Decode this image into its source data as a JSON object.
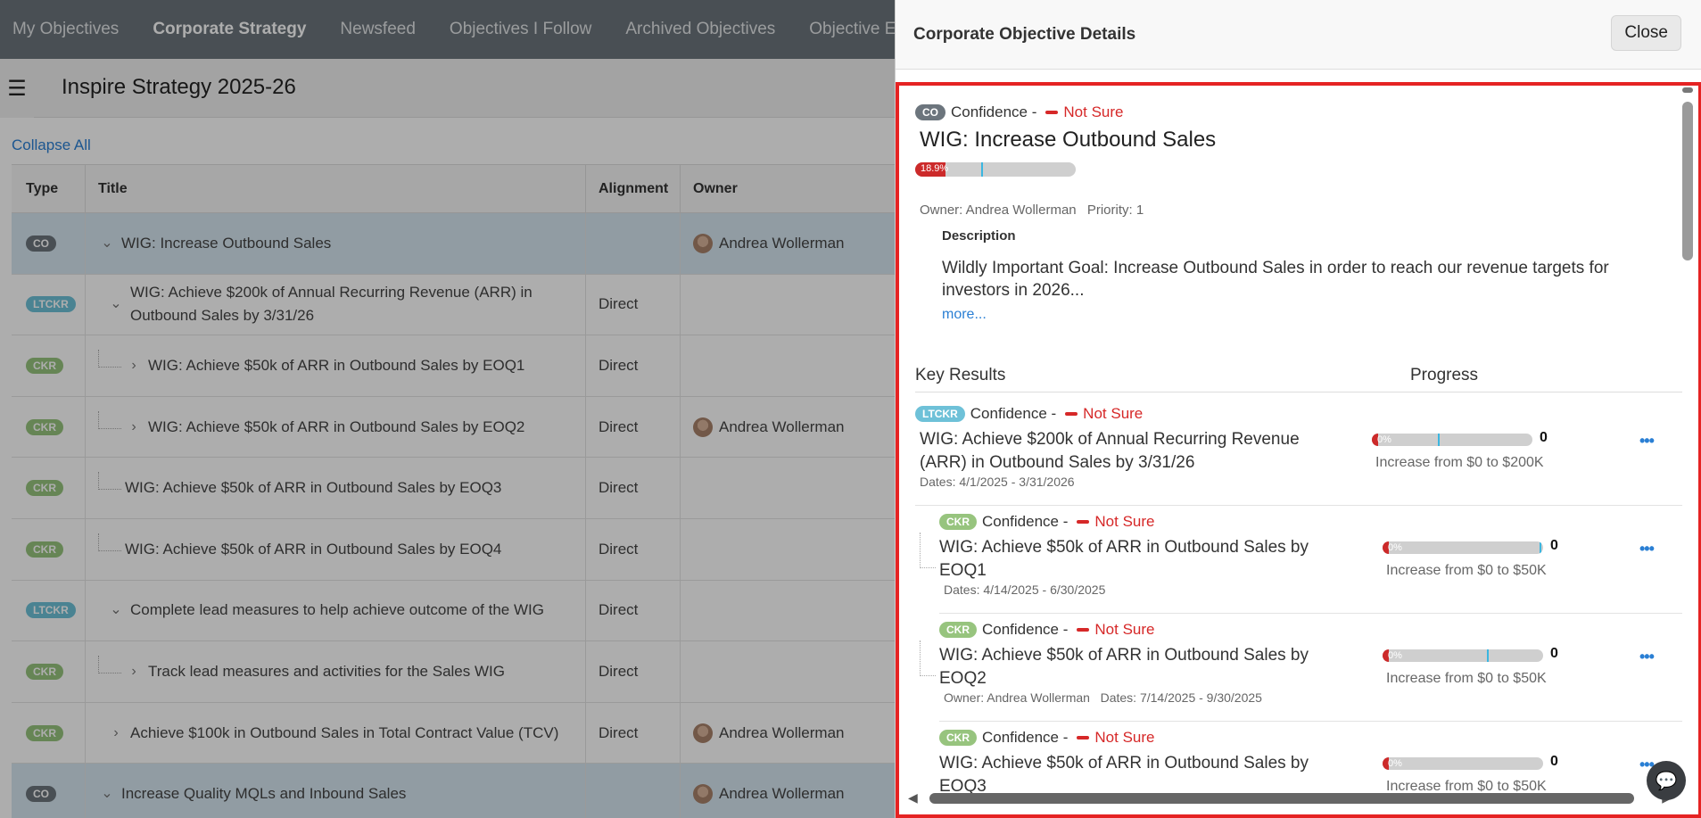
{
  "topnav": {
    "tabs": [
      {
        "label": "My Objectives"
      },
      {
        "label": "Corporate Strategy"
      },
      {
        "label": "Newsfeed"
      },
      {
        "label": "Objectives I Follow"
      },
      {
        "label": "Archived Objectives"
      },
      {
        "label": "Objective E"
      }
    ]
  },
  "page": {
    "menu_icon": "☰",
    "title": "Inspire Strategy 2025-26",
    "collapse_all": "Collapse All"
  },
  "grid": {
    "headers": {
      "type": "Type",
      "title": "Title",
      "alignment": "Alignment",
      "owner": "Owner"
    },
    "rows": [
      {
        "badge": "CO",
        "title": "WIG: Increase Outbound Sales",
        "alignment": "",
        "owner": "Andrea Wollerman"
      },
      {
        "badge": "LTCKR",
        "title": "WIG: Achieve $200k of Annual Recurring Revenue (ARR) in Outbound Sales by 3/31/26",
        "alignment": "Direct",
        "owner": ""
      },
      {
        "badge": "CKR",
        "title": "WIG: Achieve $50k of ARR in Outbound Sales by EOQ1",
        "alignment": "Direct",
        "owner": ""
      },
      {
        "badge": "CKR",
        "title": "WIG: Achieve $50k of ARR in Outbound Sales by EOQ2",
        "alignment": "Direct",
        "owner": "Andrea Wollerman"
      },
      {
        "badge": "CKR",
        "title": "WIG: Achieve $50k of ARR in Outbound Sales by EOQ3",
        "alignment": "Direct",
        "owner": ""
      },
      {
        "badge": "CKR",
        "title": "WIG: Achieve $50k of ARR in Outbound Sales by EOQ4",
        "alignment": "Direct",
        "owner": ""
      },
      {
        "badge": "LTCKR",
        "title": "Complete lead measures to help achieve outcome of the WIG",
        "alignment": "Direct",
        "owner": ""
      },
      {
        "badge": "CKR",
        "title": "Track lead measures and activities for the Sales WIG",
        "alignment": "Direct",
        "owner": ""
      },
      {
        "badge": "CKR",
        "title": "Achieve $100k in Outbound Sales in Total Contract Value (TCV)",
        "alignment": "Direct",
        "owner": "Andrea Wollerman"
      },
      {
        "badge": "CO",
        "title": "Increase Quality MQLs and Inbound Sales",
        "alignment": "",
        "owner": "Andrea Wollerman"
      }
    ]
  },
  "panel": {
    "title": "Corporate Objective Details",
    "close_label": "Close",
    "objective": {
      "badge": "CO",
      "confidence_label": "Confidence -",
      "confidence_value": "Not Sure",
      "title": "WIG: Increase Outbound Sales",
      "progress_label": "18.9%",
      "progress_value": 0.189,
      "target_marker": 0.41,
      "owner": "Owner: Andrea Wollerman",
      "priority": "Priority: 1",
      "description_label": "Description",
      "description": "Wildly Important Goal: Increase Outbound Sales in order to reach our revenue targets for investors in 2026...",
      "more_link": "more..."
    },
    "key_results_header": "Key Results",
    "progress_header": "Progress",
    "more_icon": "•••",
    "key_results": [
      {
        "badge": "LTCKR",
        "confidence_label": "Confidence -",
        "confidence_value": "Not Sure",
        "title": "WIG: Achieve $200k of Annual Recurring Revenue (ARR) in Outbound Sales by 3/31/26",
        "meta": "Dates: 4/1/2025 - 3/31/2026",
        "progress_label": "0%",
        "progress_value": 0.0,
        "target_marker": 0.41,
        "value": "0",
        "progress_desc": "Increase from $0 to $200K"
      },
      {
        "badge": "CKR",
        "confidence_label": "Confidence -",
        "confidence_value": "Not Sure",
        "title": "WIG: Achieve $50k of ARR in Outbound Sales by EOQ1",
        "meta": "Dates: 4/14/2025 - 6/30/2025",
        "progress_label": "0%",
        "progress_value": 0.0,
        "target_marker": 0.98,
        "value": "0",
        "progress_desc": "Increase from $0 to $50K"
      },
      {
        "badge": "CKR",
        "confidence_label": "Confidence -",
        "confidence_value": "Not Sure",
        "title": "WIG: Achieve $50k of ARR in Outbound Sales by EOQ2",
        "meta": "Owner: Andrea Wollerman   Dates: 7/14/2025 - 9/30/2025",
        "progress_label": "0%",
        "progress_value": 0.0,
        "target_marker": 0.65,
        "value": "0",
        "progress_desc": "Increase from $0 to $50K"
      },
      {
        "badge": "CKR",
        "confidence_label": "Confidence -",
        "confidence_value": "Not Sure",
        "title": "WIG: Achieve $50k of ARR in Outbound Sales by EOQ3",
        "meta": "",
        "progress_label": "0%",
        "progress_value": 0.0,
        "target_marker": 0.0,
        "value": "0",
        "progress_desc": "Increase from $0 to $50K"
      }
    ],
    "chat_icon": "💬"
  },
  "colors": {
    "nav_bg": "#6c757d",
    "accent_link": "#2a7fd4",
    "not_sure": "#d62828",
    "highlight_border": "#e52323",
    "badge_co": "#6c757d",
    "badge_ltckr": "#6ec1d8",
    "badge_ckr": "#97c47e"
  }
}
